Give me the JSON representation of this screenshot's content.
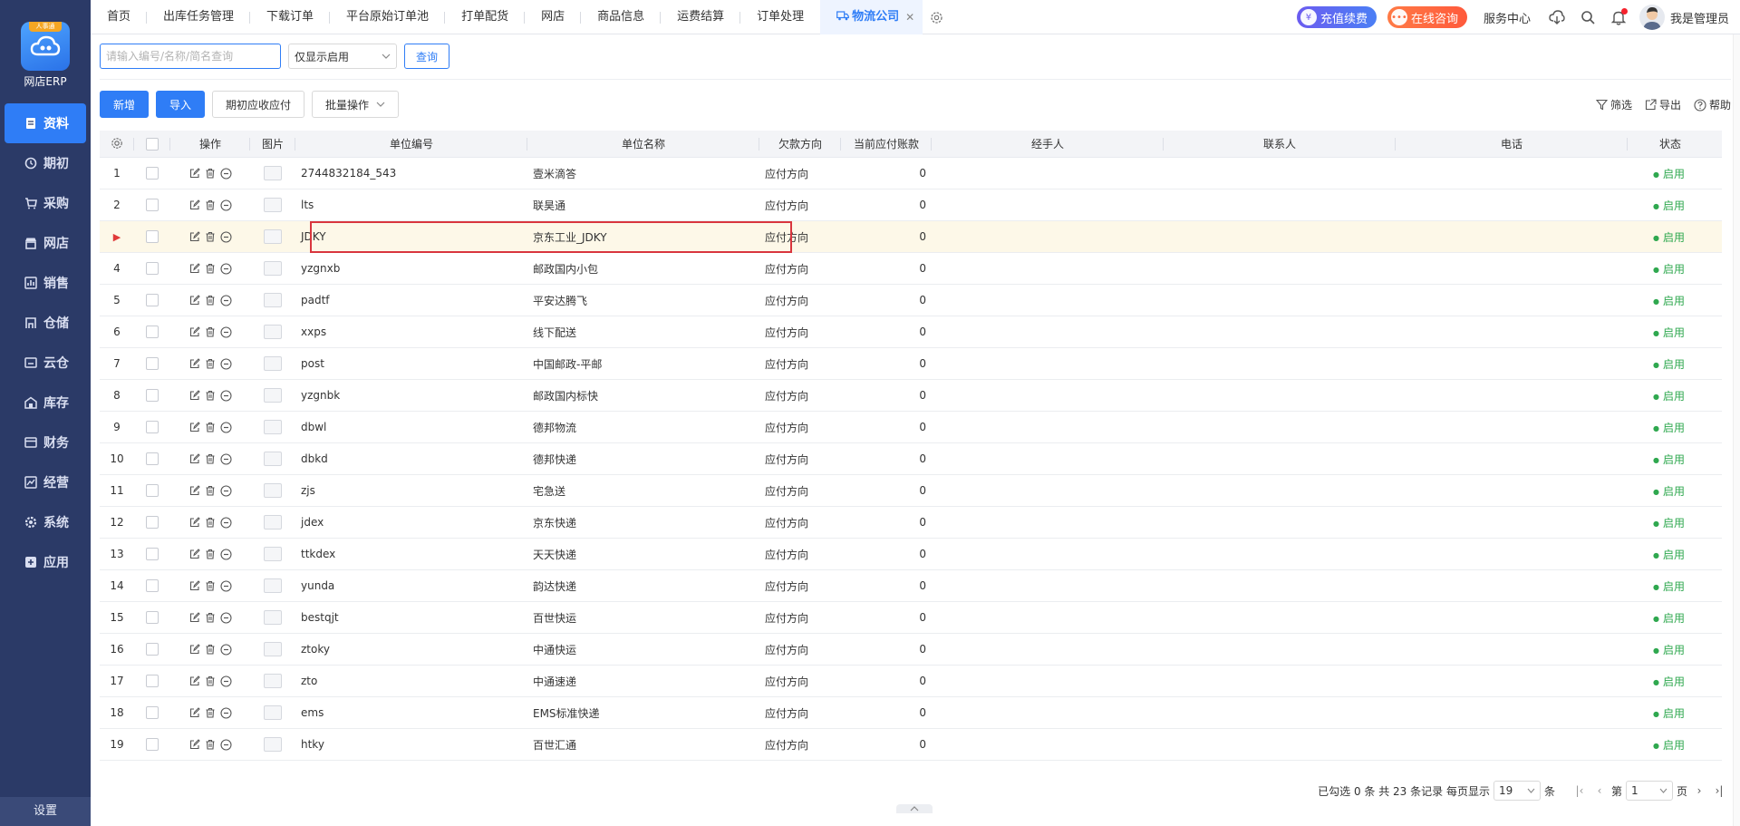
{
  "app": {
    "logo_badge": "人事通",
    "logo_title": "网店ERP"
  },
  "sidebar": {
    "items": [
      {
        "label": "资料",
        "icon": "document-icon"
      },
      {
        "label": "期初",
        "icon": "clock-icon"
      },
      {
        "label": "采购",
        "icon": "cart-icon"
      },
      {
        "label": "网店",
        "icon": "shop-icon"
      },
      {
        "label": "销售",
        "icon": "chart-icon"
      },
      {
        "label": "仓储",
        "icon": "warehouse-icon"
      },
      {
        "label": "云仓",
        "icon": "cloud-icon"
      },
      {
        "label": "库存",
        "icon": "inventory-icon"
      },
      {
        "label": "财务",
        "icon": "finance-icon"
      },
      {
        "label": "经营",
        "icon": "business-icon"
      },
      {
        "label": "系统",
        "icon": "gear-icon"
      },
      {
        "label": "应用",
        "icon": "plus-icon"
      }
    ],
    "footer": "设置"
  },
  "tabs": [
    {
      "label": "首页"
    },
    {
      "label": "出库任务管理"
    },
    {
      "label": "下载订单"
    },
    {
      "label": "平台原始订单池"
    },
    {
      "label": "打单配货"
    },
    {
      "label": "网店"
    },
    {
      "label": "商品信息"
    },
    {
      "label": "运费结算"
    },
    {
      "label": "订单处理"
    },
    {
      "label": "物流公司",
      "active": true
    }
  ],
  "topright": {
    "recharge": "充值续费",
    "consult": "在线咨询",
    "service": "服务中心",
    "user": "我是管理员"
  },
  "search": {
    "placeholder": "请输入编号/名称/简名查询",
    "value": "",
    "filter_selected": "仅显示启用",
    "query_button": "查询"
  },
  "toolbar": {
    "add": "新增",
    "import": "导入",
    "opening": "期初应收应付",
    "batch": "批量操作",
    "filter": "筛选",
    "export": "导出",
    "help": "帮助"
  },
  "table": {
    "headers": {
      "op": "操作",
      "img": "图片",
      "code": "单位编号",
      "name": "单位名称",
      "dir": "欠款方向",
      "amt": "当前应付账款",
      "handler": "经手人",
      "contact": "联系人",
      "phone": "电话",
      "status": "状态"
    },
    "rows": [
      {
        "no": "1",
        "code": "2744832184_543",
        "name": "壹米滴答",
        "dir": "应付方向",
        "amt": "0",
        "status": "启用"
      },
      {
        "no": "2",
        "code": "lts",
        "name": "联昊通",
        "dir": "应付方向",
        "amt": "0",
        "status": "启用"
      },
      {
        "no": "",
        "code": "JDKY",
        "name": "京东工业_JDKY",
        "dir": "应付方向",
        "amt": "0",
        "status": "启用",
        "current": true
      },
      {
        "no": "4",
        "code": "yzgnxb",
        "name": "邮政国内小包",
        "dir": "应付方向",
        "amt": "0",
        "status": "启用"
      },
      {
        "no": "5",
        "code": "padtf",
        "name": "平安达腾飞",
        "dir": "应付方向",
        "amt": "0",
        "status": "启用"
      },
      {
        "no": "6",
        "code": "xxps",
        "name": "线下配送",
        "dir": "应付方向",
        "amt": "0",
        "status": "启用"
      },
      {
        "no": "7",
        "code": "post",
        "name": "中国邮政-平邮",
        "dir": "应付方向",
        "amt": "0",
        "status": "启用"
      },
      {
        "no": "8",
        "code": "yzgnbk",
        "name": "邮政国内标快",
        "dir": "应付方向",
        "amt": "0",
        "status": "启用"
      },
      {
        "no": "9",
        "code": "dbwl",
        "name": "德邦物流",
        "dir": "应付方向",
        "amt": "0",
        "status": "启用"
      },
      {
        "no": "10",
        "code": "dbkd",
        "name": "德邦快递",
        "dir": "应付方向",
        "amt": "0",
        "status": "启用"
      },
      {
        "no": "11",
        "code": "zjs",
        "name": "宅急送",
        "dir": "应付方向",
        "amt": "0",
        "status": "启用"
      },
      {
        "no": "12",
        "code": "jdex",
        "name": "京东快递",
        "dir": "应付方向",
        "amt": "0",
        "status": "启用"
      },
      {
        "no": "13",
        "code": "ttkdex",
        "name": "天天快递",
        "dir": "应付方向",
        "amt": "0",
        "status": "启用"
      },
      {
        "no": "14",
        "code": "yunda",
        "name": "韵达快递",
        "dir": "应付方向",
        "amt": "0",
        "status": "启用"
      },
      {
        "no": "15",
        "code": "bestqjt",
        "name": "百世快运",
        "dir": "应付方向",
        "amt": "0",
        "status": "启用"
      },
      {
        "no": "16",
        "code": "ztoky",
        "name": "中通快运",
        "dir": "应付方向",
        "amt": "0",
        "status": "启用"
      },
      {
        "no": "17",
        "code": "zto",
        "name": "中通速递",
        "dir": "应付方向",
        "amt": "0",
        "status": "启用"
      },
      {
        "no": "18",
        "code": "ems",
        "name": "EMS标准快递",
        "dir": "应付方向",
        "amt": "0",
        "status": "启用"
      },
      {
        "no": "19",
        "code": "htky",
        "name": "百世汇通",
        "dir": "应付方向",
        "amt": "0",
        "status": "启用"
      }
    ]
  },
  "pager": {
    "summary": "已勾选 0 条 共 23 条记录 每页显示",
    "per_page": "19",
    "unit": "条",
    "page_prefix": "第",
    "page": "1",
    "page_suffix": "页"
  },
  "colors": {
    "accent": "#2f7df6",
    "sidebar": "#2b3a67",
    "status_green": "#2fa84f",
    "highlight_border": "#d9363e"
  }
}
